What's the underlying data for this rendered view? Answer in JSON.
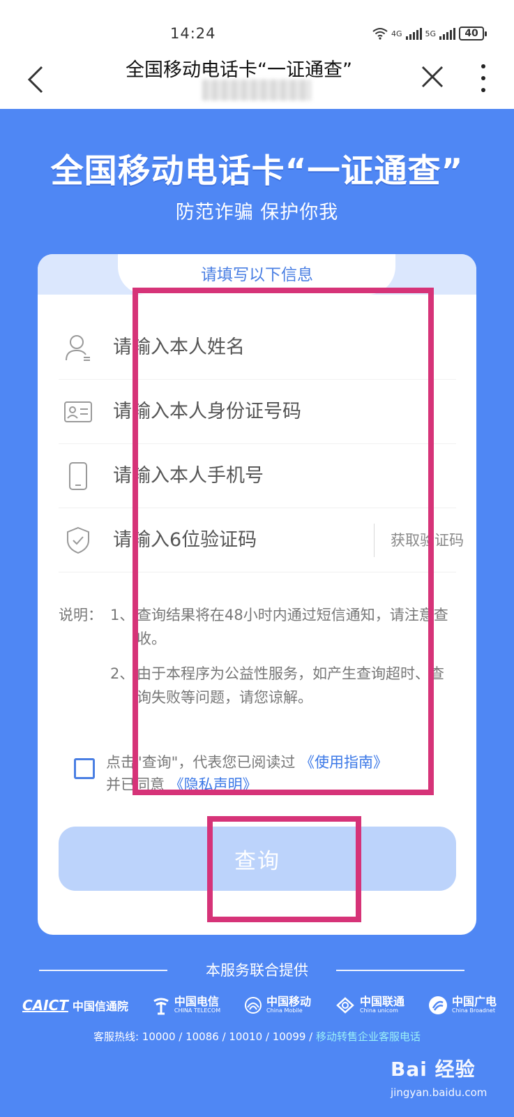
{
  "status_bar": {
    "time": "14:24",
    "network_1": "4G",
    "network_2": "5G",
    "battery": "40"
  },
  "nav": {
    "title": "全国移动电话卡“一证通查”"
  },
  "hero": {
    "title": "全国移动电话卡“一证通查”",
    "subtitle": "防范诈骗 保护你我"
  },
  "form": {
    "header": "请填写以下信息",
    "name_placeholder": "请输入本人姓名",
    "id_placeholder": "请输入本人身份证号码",
    "phone_placeholder": "请输入本人手机号",
    "code_placeholder": "请输入6位验证码",
    "get_code_label": "获取验证码"
  },
  "notes": {
    "label": "说明：",
    "items": [
      {
        "num": "1、",
        "text": "查询结果将在48小时内通过短信通知，请注意查收。"
      },
      {
        "num": "2、",
        "text": "由于本程序为公益性服务，如产生查询超时、查询失败等问题，请您谅解。"
      }
    ]
  },
  "agreement": {
    "prefix": "点击\"查询\"，代表您已阅读过",
    "guide_link": "《使用指南》",
    "middle": "并已同意",
    "privacy_link": "《隐私声明》"
  },
  "query_button": "查询",
  "footer": {
    "title": "本服务联合提供",
    "logos": [
      {
        "icon": "caict-logo",
        "main": "CAICT",
        "cn": "中国信通院"
      },
      {
        "icon": "china-telecom-logo",
        "main": "中国电信",
        "en": "CHINA TELECOM"
      },
      {
        "icon": "china-mobile-logo",
        "main": "中国移动",
        "en": "China Mobile"
      },
      {
        "icon": "china-unicom-logo",
        "main": "中国联通",
        "en": "China unicom"
      },
      {
        "icon": "china-broadnet-logo",
        "main": "中国广电",
        "en": "China Broadnet"
      }
    ],
    "hotline_prefix": "客服热线: 10000 / 10086 / 10010 / 10099 / ",
    "hotline_link": "移动转售企业客服电话"
  },
  "watermark": {
    "main": "Bai 经验",
    "url": "jingyan.baidu.com"
  },
  "colors": {
    "page_bg": "#4f87f4",
    "accent": "#4a7fe3",
    "button_disabled": "#bcd3fb",
    "highlight": "#d63378",
    "link": "#3b78e7"
  }
}
